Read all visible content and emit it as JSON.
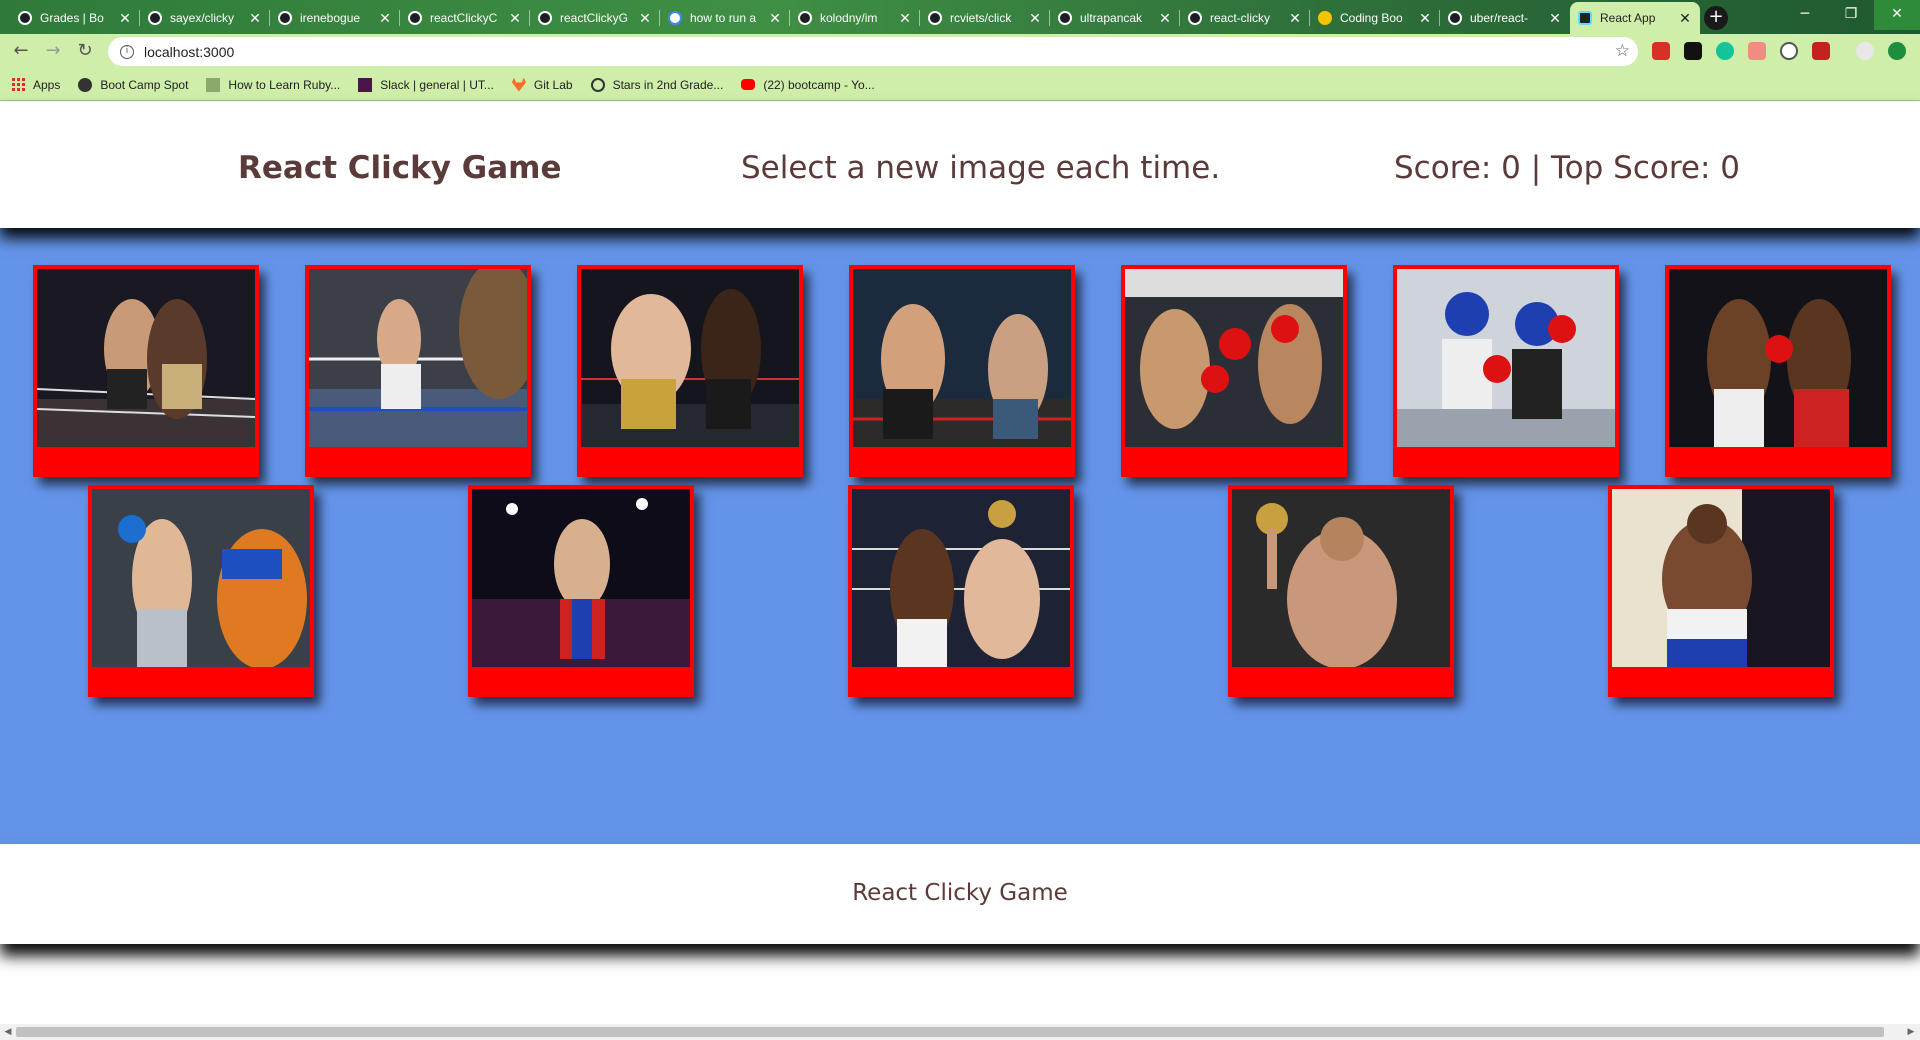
{
  "browser": {
    "tabs": [
      {
        "title": "Grades | Bo",
        "icon": "globe-icon"
      },
      {
        "title": "sayex/clicky",
        "icon": "github-icon"
      },
      {
        "title": "irenebogue",
        "icon": "github-icon"
      },
      {
        "title": "reactClickyC",
        "icon": "github-icon"
      },
      {
        "title": "reactClickyG",
        "icon": "github-icon"
      },
      {
        "title": "how to run a",
        "icon": "google-icon"
      },
      {
        "title": "kolodny/im",
        "icon": "github-icon"
      },
      {
        "title": "rcviets/click",
        "icon": "github-icon"
      },
      {
        "title": "ultrapancak",
        "icon": "github-icon"
      },
      {
        "title": "react-clicky",
        "icon": "globe-icon"
      },
      {
        "title": "Coding Boo",
        "icon": "smiley-icon"
      },
      {
        "title": "uber/react-",
        "icon": "github-icon"
      },
      {
        "title": "React App",
        "icon": "react-icon",
        "active": true
      }
    ],
    "new_tab_symbol": "+",
    "url": "localhost:3000",
    "bookmarks": [
      {
        "label": "Apps",
        "icon": "apps-grid-icon"
      },
      {
        "label": "Boot Camp Spot",
        "icon": "globe-icon"
      },
      {
        "label": "How to Learn Ruby...",
        "icon": "bookmark-icon"
      },
      {
        "label": "Slack | general | UT...",
        "icon": "slack-icon"
      },
      {
        "label": "Git Lab",
        "icon": "gitlab-icon"
      },
      {
        "label": "Stars in 2nd Grade...",
        "icon": "wordpress-icon"
      },
      {
        "label": "(22) bootcamp - Yo...",
        "icon": "youtube-icon"
      }
    ]
  },
  "app": {
    "brand": "React Clicky Game",
    "message": "Select a new image each time.",
    "score_text": "Score: 0 | Top Score: 0",
    "footer": "React Clicky Game",
    "colors": {
      "card_border": "#ff0000",
      "game_bg": "#6494ea",
      "text": "#5a3b39"
    },
    "cards_row1": [
      {
        "alt": "boxer-1"
      },
      {
        "alt": "boxer-2"
      },
      {
        "alt": "boxer-3"
      },
      {
        "alt": "boxer-4"
      },
      {
        "alt": "boxer-5"
      },
      {
        "alt": "boxer-6"
      },
      {
        "alt": "boxer-7"
      }
    ],
    "cards_row2": [
      {
        "alt": "boxer-8"
      },
      {
        "alt": "boxer-9"
      },
      {
        "alt": "boxer-10"
      },
      {
        "alt": "boxer-11"
      },
      {
        "alt": "boxer-12"
      }
    ]
  }
}
